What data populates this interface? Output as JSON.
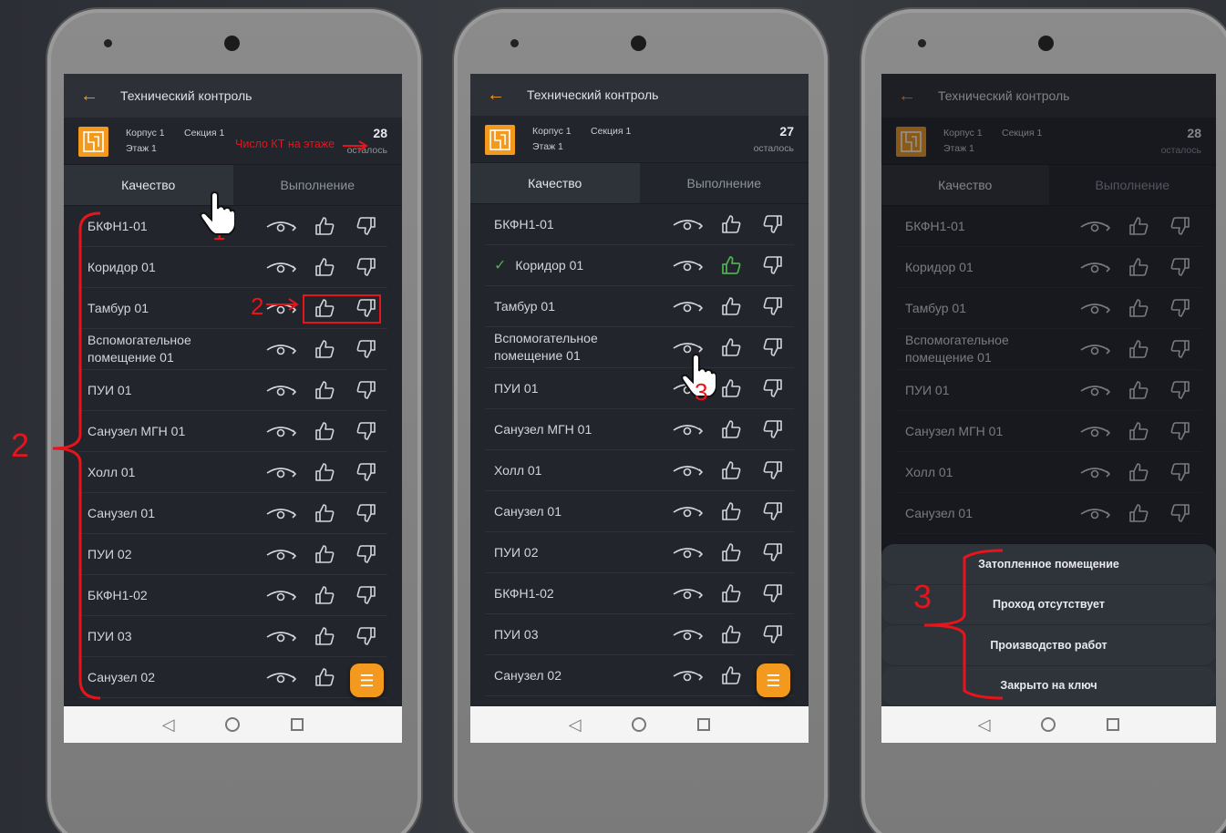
{
  "screens": [
    {
      "title": "Технический контроль",
      "korpus": "Корпус 1",
      "sekciya": "Секция 1",
      "etazh": "Этаж 1",
      "remaining_count": "28",
      "remaining_label": "осталось",
      "tabs": [
        "Качество",
        "Выполнение"
      ]
    },
    {
      "title": "Технический контроль",
      "korpus": "Корпус 1",
      "sekciya": "Секция 1",
      "etazh": "Этаж 1",
      "remaining_count": "27",
      "remaining_label": "осталось",
      "tabs": [
        "Качество",
        "Выполнение"
      ]
    },
    {
      "title": "Технический контроль",
      "korpus": "Корпус 1",
      "sekciya": "Секция 1",
      "etazh": "Этаж 1",
      "remaining_count": "28",
      "remaining_label": "осталось",
      "tabs": [
        "Качество",
        "Выполнение"
      ]
    }
  ],
  "rooms_full": [
    "БКФН1-01",
    "Коридор 01",
    "Тамбур 01",
    "Вспомогательное помещение 01",
    "ПУИ 01",
    "Санузел МГН 01",
    "Холл 01",
    "Санузел 01",
    "ПУИ 02",
    "БКФН1-02",
    "ПУИ 03",
    "Санузел 02"
  ],
  "sheet_options": [
    "Затопленное помещение",
    "Проход отсутствует",
    "Производство работ",
    "Закрыто на ключ"
  ],
  "annotations": {
    "kt_label": "Число КТ на этаже",
    "n1": "1",
    "n2": "2",
    "n3": "3"
  },
  "colors": {
    "accent": "#f39a1e",
    "annotation": "#e8141b",
    "check": "#4caf50"
  },
  "icons": {
    "back": "back-arrow-icon",
    "eye": "eye-closed-icon",
    "like": "thumb-up-icon",
    "dislike": "thumb-down-icon",
    "menu": "menu-icon"
  }
}
